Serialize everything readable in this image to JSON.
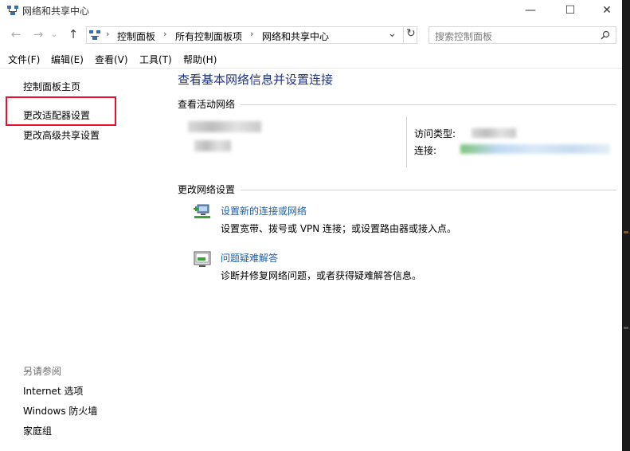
{
  "window": {
    "title": "网络和共享中心"
  },
  "caption": {
    "minimize": "—",
    "maximize": "☐",
    "close": "✕"
  },
  "nav": {
    "back_icon": "arrow-left-icon",
    "forward_icon": "arrow-right-icon",
    "up_icon": "arrow-up-icon",
    "breadcrumb": [
      "控制面板",
      "所有控制面板项",
      "网络和共享中心"
    ],
    "dropdown_glyph": "⌄",
    "refresh_glyph": "↻"
  },
  "search": {
    "placeholder": "搜索控制面板"
  },
  "menu": [
    "文件(F)",
    "编辑(E)",
    "查看(V)",
    "工具(T)",
    "帮助(H)"
  ],
  "sidebar": {
    "links": [
      "控制面板主页",
      "更改适配器设置",
      "更改高级共享设置"
    ],
    "see_also_heading": "另请参阅",
    "see_also": [
      "Internet 选项",
      "Windows 防火墙",
      "家庭组"
    ]
  },
  "main": {
    "title": "查看基本网络信息并设置连接",
    "active_networks_heading": "查看活动网络",
    "access_type_label": "访问类型:",
    "connection_label": "连接:",
    "change_settings_heading": "更改网络设置",
    "tasks": [
      {
        "link": "设置新的连接或网络",
        "desc": "设置宽带、拨号或 VPN 连接；或设置路由器或接入点。"
      },
      {
        "link": "问题疑难解答",
        "desc": "诊断并修复网络问题，或者获得疑难解答信息。"
      }
    ]
  },
  "colors": {
    "link": "#1a5dab",
    "title": "#1e3287",
    "highlight": "#e8112d"
  }
}
